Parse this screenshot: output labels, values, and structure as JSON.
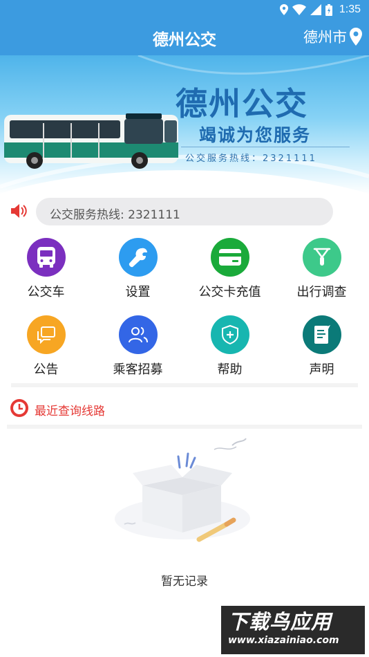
{
  "status_bar": {
    "time": "1:35",
    "icons": [
      "location-icon",
      "wifi-icon",
      "signal-icon",
      "battery-icon"
    ]
  },
  "app_bar": {
    "title": "德州公交",
    "city": "德州市",
    "city_icon": "location-pin-icon"
  },
  "banner": {
    "title": "德州公交",
    "subtitle": "竭诚为您服务",
    "hotline": "公交服务热线：2321111",
    "bus_sign": "德州公交"
  },
  "notice": {
    "icon": "speaker-icon",
    "text": "公交服务热线:  2321111"
  },
  "grid": [
    {
      "label": "公交车",
      "icon": "bus-icon",
      "color": "#7b2fbf"
    },
    {
      "label": "设置",
      "icon": "wrench-icon",
      "color": "#2d9cf0"
    },
    {
      "label": "公交卡充值",
      "icon": "card-icon",
      "color": "#1aaa3a"
    },
    {
      "label": "出行调查",
      "icon": "bicycle-icon",
      "color": "#3dc98a"
    },
    {
      "label": "公告",
      "icon": "chat-icon",
      "color": "#f7a623"
    },
    {
      "label": "乘客招募",
      "icon": "users-icon",
      "color": "#3366e6"
    },
    {
      "label": "帮助",
      "icon": "shield-plus-icon",
      "color": "#17b6b0"
    },
    {
      "label": "声明",
      "icon": "note-icon",
      "color": "#0b7a78"
    }
  ],
  "recent": {
    "icon": "clock-icon",
    "label": "最近查询线路"
  },
  "empty": {
    "icon": "empty-box-icon",
    "text": "暂无记录"
  },
  "watermark": {
    "title": "下载鸟应用",
    "url": "www.xiazainiao.com"
  },
  "colors": {
    "primary": "#3c9be0",
    "accent_red": "#e53935"
  }
}
